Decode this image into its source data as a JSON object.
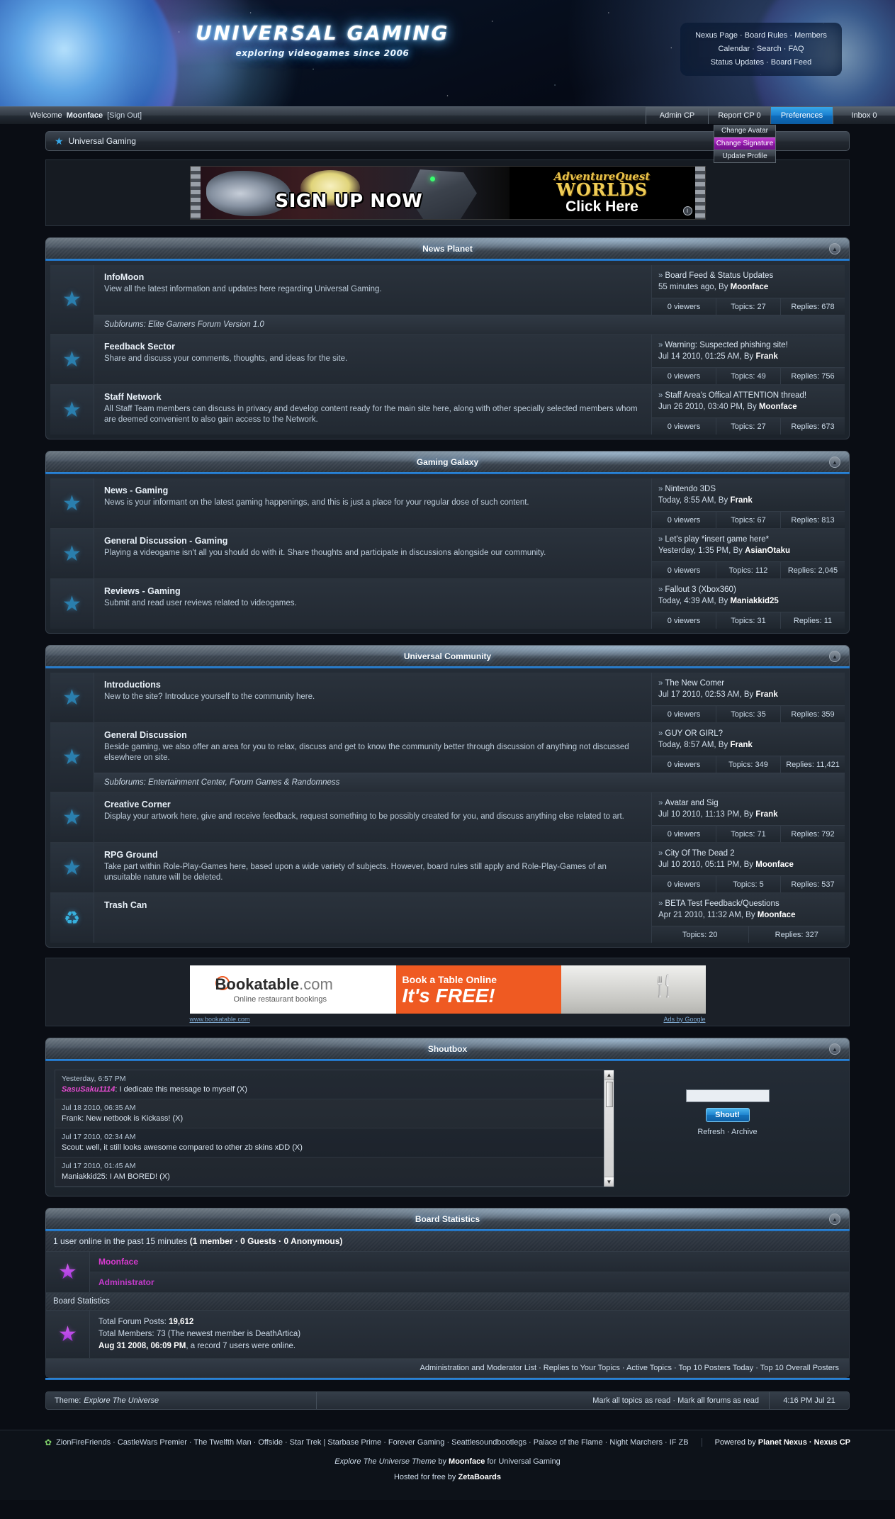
{
  "header": {
    "logo_title": "UNIVERSAL GAMING",
    "logo_subtitle": "exploring videogames since 2006",
    "nav_line1": "Nexus Page · Board Rules · Members",
    "nav_line2": "Calendar · Search · FAQ",
    "nav_line3": "Status Updates · Board Feed"
  },
  "userbar": {
    "welcome_prefix": "Welcome",
    "username": "Moonface",
    "signout": "[Sign Out]",
    "buttons": [
      {
        "label": "Admin CP",
        "active": false
      },
      {
        "label": "Report CP 0",
        "active": false
      },
      {
        "label": "Preferences",
        "active": true
      },
      {
        "label": "Inbox 0",
        "active": false
      }
    ],
    "dropdown": [
      {
        "label": "Change Avatar",
        "highlighted": false
      },
      {
        "label": "Change Signature",
        "highlighted": true
      },
      {
        "label": "Update Profile",
        "highlighted": false
      }
    ]
  },
  "breadcrumb": {
    "label": "Universal Gaming"
  },
  "ads": {
    "aq": {
      "signup": "SIGN UP NOW",
      "brand_top": "AdventureQuest",
      "brand_mid": "WORLDS",
      "cta": "Click Here",
      "info": "i"
    },
    "bookatable": {
      "brand": "Bookatable",
      "brand_com": ".com",
      "tagline": "Online restaurant bookings",
      "headline_small": "Book a Table Online",
      "headline_big": "It's FREE!",
      "url": "www.bookatable.com",
      "by": "Ads by Google"
    }
  },
  "categories": [
    {
      "title": "News Planet",
      "forums": [
        {
          "icon": "star-icon",
          "name": "InfoMoon",
          "description": "View all the latest information and updates here regarding Universal Gaming.",
          "subforums": "Subforums: Elite Gamers Forum Version 1.0",
          "last_title": "Board Feed & Status Updates",
          "last_meta": "55 minutes ago, By ",
          "last_author": "Moonface",
          "viewers": "0 viewers",
          "topics": "Topics: 27",
          "replies": "Replies: 678"
        },
        {
          "icon": "star-icon",
          "name": "Feedback Sector",
          "description": "Share and discuss your comments, thoughts, and ideas for the site.",
          "subforums": "",
          "last_title": "Warning: Suspected phishing site!",
          "last_meta": "Jul 14 2010, 01:25 AM, By ",
          "last_author": "Frank",
          "viewers": "0 viewers",
          "topics": "Topics: 49",
          "replies": "Replies: 756"
        },
        {
          "icon": "star-icon",
          "name": "Staff Network",
          "description": "All Staff Team members can discuss in privacy and develop content ready for the main site here, along with other specially selected members whom are deemed convenient to also gain access to the Network.",
          "subforums": "",
          "last_title": "Staff Area's Offical ATTENTION thread!",
          "last_meta": "Jun 26 2010, 03:40 PM, By ",
          "last_author": "Moonface",
          "viewers": "0 viewers",
          "topics": "Topics: 27",
          "replies": "Replies: 673"
        }
      ]
    },
    {
      "title": "Gaming Galaxy",
      "forums": [
        {
          "icon": "star-icon",
          "name": "News - Gaming",
          "description": "News is your informant on the latest gaming happenings, and this is just a place for your regular dose of such content.",
          "subforums": "",
          "last_title": "Nintendo 3DS",
          "last_meta": "Today, 8:55 AM, By ",
          "last_author": "Frank",
          "viewers": "0 viewers",
          "topics": "Topics: 67",
          "replies": "Replies: 813"
        },
        {
          "icon": "star-icon",
          "name": "General Discussion - Gaming",
          "description": "Playing a videogame isn't all you should do with it. Share thoughts and participate in discussions alongside our community.",
          "subforums": "",
          "last_title": "Let's play *insert game here*",
          "last_meta": "Yesterday, 1:35 PM, By ",
          "last_author": "AsianOtaku",
          "viewers": "0 viewers",
          "topics": "Topics: 112",
          "replies": "Replies: 2,045"
        },
        {
          "icon": "star-icon",
          "name": "Reviews - Gaming",
          "description": "Submit and read user reviews related to videogames.",
          "subforums": "",
          "last_title": "Fallout 3 (Xbox360)",
          "last_meta": "Today, 4:39 AM, By ",
          "last_author": "Maniakkid25",
          "viewers": "0 viewers",
          "topics": "Topics: 31",
          "replies": "Replies: 11"
        }
      ]
    },
    {
      "title": "Universal Community",
      "forums": [
        {
          "icon": "star-icon",
          "name": "Introductions",
          "description": "New to the site? Introduce yourself to the community here.",
          "subforums": "",
          "last_title": "The New Comer",
          "last_meta": "Jul 17 2010, 02:53 AM, By ",
          "last_author": "Frank",
          "viewers": "0 viewers",
          "topics": "Topics: 35",
          "replies": "Replies: 359"
        },
        {
          "icon": "star-icon",
          "name": "General Discussion",
          "description": "Beside gaming, we also offer an area for you to relax, discuss and get to know the community better through discussion of anything not discussed elsewhere on site.",
          "subforums": "Subforums: Entertainment Center, Forum Games & Randomness",
          "last_title": "GUY OR GIRL?",
          "last_meta": "Today, 8:57 AM, By ",
          "last_author": "Frank",
          "viewers": "0 viewers",
          "topics": "Topics: 349",
          "replies": "Replies: 11,421"
        },
        {
          "icon": "star-icon",
          "name": "Creative Corner",
          "description": "Display your artwork here, give and receive feedback, request something to be possibly created for you, and discuss anything else related to art.",
          "subforums": "",
          "last_title": "Avatar and Sig",
          "last_meta": "Jul 10 2010, 11:13 PM, By ",
          "last_author": "Frank",
          "viewers": "0 viewers",
          "topics": "Topics: 71",
          "replies": "Replies: 792"
        },
        {
          "icon": "star-icon",
          "name": "RPG Ground",
          "description": "Take part within Role-Play-Games here, based upon a wide variety of subjects. However, board rules still apply and Role-Play-Games of an unsuitable nature will be deleted.",
          "subforums": "",
          "last_title": "City Of The Dead 2",
          "last_meta": "Jul 10 2010, 05:11 PM, By ",
          "last_author": "Moonface",
          "viewers": "0 viewers",
          "topics": "Topics: 5",
          "replies": "Replies: 537"
        },
        {
          "icon": "recycle-icon",
          "name": "Trash Can",
          "description": "",
          "subforums": "",
          "last_title": "BETA Test Feedback/Questions",
          "last_meta": "Apr 21 2010, 11:32 AM, By ",
          "last_author": "Moonface",
          "viewers": "",
          "topics": "Topics: 20",
          "replies": "Replies: 327"
        }
      ]
    }
  ],
  "shoutbox": {
    "title": "Shoutbox",
    "messages": [
      {
        "time": "Yesterday, 6:57 PM",
        "user": "SasuSaku1114",
        "pink": true,
        "text": ": I dedicate this message to myself (X)"
      },
      {
        "time": "Jul 18 2010, 06:35 AM",
        "user": "Frank",
        "pink": false,
        "text": ": New netbook is Kickass! (X)"
      },
      {
        "time": "Jul 17 2010, 02:34 AM",
        "user": "Scout",
        "pink": false,
        "text": ": well, it still looks awesome compared to other zb skins xDD (X)"
      },
      {
        "time": "Jul 17 2010, 01:45 AM",
        "user": "Maniakkid25",
        "pink": false,
        "text": ": I AM BORED! (X)"
      }
    ],
    "input_placeholder": "",
    "input_value": "",
    "button": "Shout!",
    "links": "Refresh · Archive"
  },
  "board_stats": {
    "title": "Board Statistics",
    "online_prefix": "1 user online in the past 15 minutes ",
    "online_bold": "(1 member · 0 Guests · 0 Anonymous)",
    "member_name": "Moonface",
    "member_rank": "Administrator",
    "section_label": "Board Statistics",
    "total_posts_label": "Total Forum Posts: ",
    "total_posts": "19,612",
    "total_members_label": "Total Members: ",
    "total_members": "73 (The newest member is DeathArtica)",
    "record_bold": "Aug 31 2008, 06:09 PM",
    "record_rest": ", a record 7 users were online.",
    "links": "Administration and Moderator List · Replies to Your Topics · Active Topics · Top 10 Posters Today · Top 10 Overall Posters"
  },
  "themebar": {
    "theme_label": "Theme: ",
    "theme_name": "Explore The Universe",
    "mark_links": "Mark all topics as read · Mark all forums as read",
    "time": "4:16 PM Jul 21"
  },
  "footer": {
    "affiliates": "ZionFireFriends · CastleWars Premier · The Twelfth Man · Offside · Star Trek | Starbase Prime · Forever Gaming · Seattlesoundbootlegs · Palace of the Flame · Night Marchers · IF ZB",
    "powered_prefix": "Powered by ",
    "powered_bold": "Planet Nexus · Nexus CP",
    "theme_credit_name": "Explore The Universe Theme",
    "theme_credit_by": " by ",
    "theme_credit_author": "Moonface",
    "theme_credit_for": " for Universal Gaming",
    "hosted_prefix": "Hosted for free by ",
    "hosted_bold": "ZetaBoards"
  }
}
